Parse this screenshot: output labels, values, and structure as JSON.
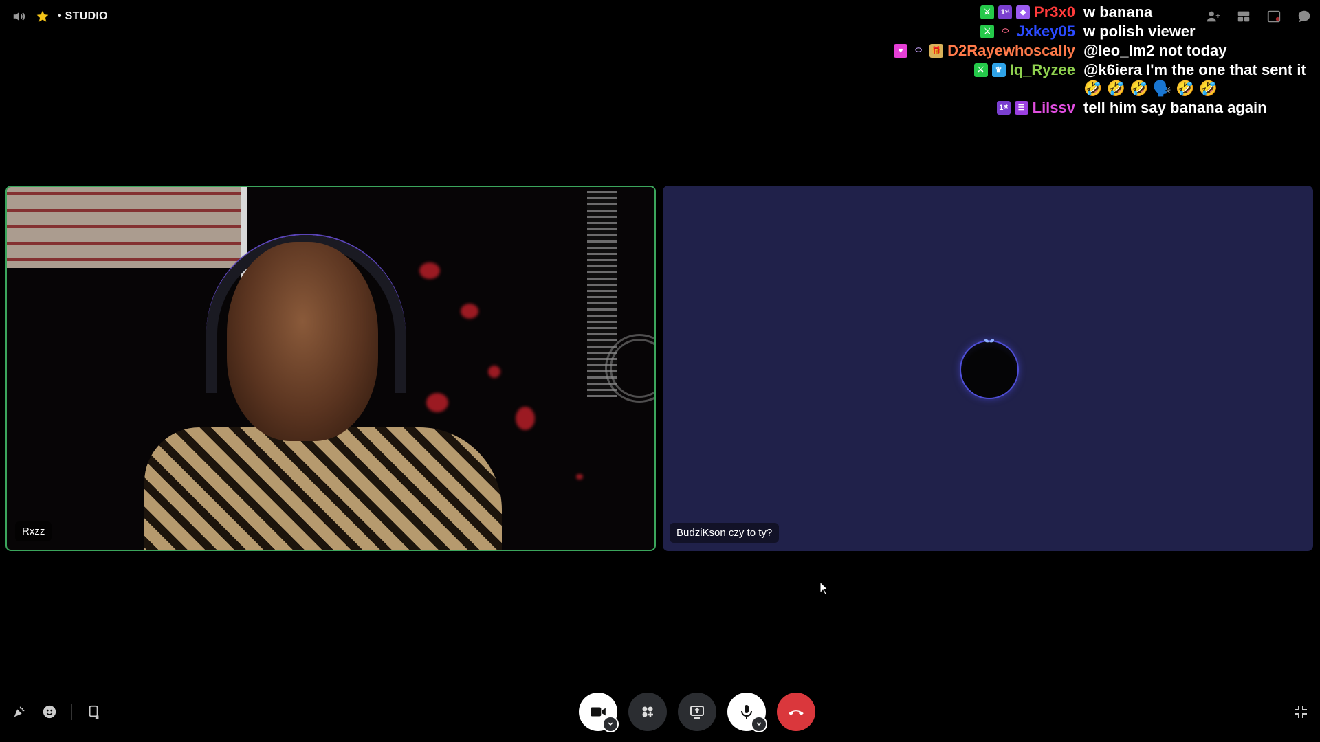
{
  "window": {
    "studio_label": "STUDIO",
    "dot": "•"
  },
  "chat": [
    {
      "badges": [
        "mod-sword",
        "1st",
        "gem"
      ],
      "username": "Pr3x0",
      "color": "#ff3b3b",
      "message": "w banana"
    },
    {
      "badges": [
        "mod-sword",
        "ring"
      ],
      "username": "Jxkey05",
      "color": "#2b4bff",
      "message": "w polish viewer"
    },
    {
      "badges": [
        "heart",
        "ring",
        "gift"
      ],
      "username": "D2Rayewhoscally",
      "color": "#ff7a4a",
      "message": "@leo_lm2 not today"
    },
    {
      "badges": [
        "mod-sword",
        "crown"
      ],
      "username": "Iq_Ryzee",
      "color": "#8fd14f",
      "message": "@k6iera I'm the one that sent it 🤣 🤣 🤣 🗣️ 🤣 🤣"
    },
    {
      "badges": [
        "1st",
        "book"
      ],
      "username": "Lilssv",
      "color": "#e14ee0",
      "message": "tell him say banana again"
    }
  ],
  "tiles": [
    {
      "label": "Rxzz",
      "speaking": true
    },
    {
      "label": "BudziKson czy to ty?",
      "speaking": false
    }
  ],
  "controls": {
    "camera": "camera-button",
    "activities": "activities-button",
    "share": "screen-share-button",
    "mic": "mic-button",
    "leave": "leave-call-button"
  },
  "colors": {
    "speaking_border": "#3ba55c",
    "leave": "#da373c",
    "tile_bg": "#20214a"
  }
}
